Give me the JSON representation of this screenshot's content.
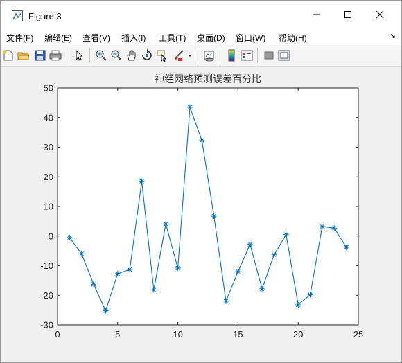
{
  "window": {
    "title": "Figure 3",
    "controls": {
      "minimize": "minimize",
      "maximize": "maximize",
      "close": "close"
    }
  },
  "menubar": {
    "items": [
      {
        "label": "文件(F)"
      },
      {
        "label": "编辑(E)"
      },
      {
        "label": "查看(V)"
      },
      {
        "label": "插入(I)"
      },
      {
        "label": "工具(T)"
      },
      {
        "label": "桌面(D)"
      },
      {
        "label": "窗口(W)"
      },
      {
        "label": "帮助(H)"
      }
    ],
    "overflow_icon": "dock-arrow-icon"
  },
  "toolbar": {
    "icons": [
      "new-figure-icon",
      "open-icon",
      "save-icon",
      "print-icon",
      "pointer-icon",
      "zoom-in-icon",
      "zoom-out-icon",
      "pan-icon",
      "rotate-icon",
      "data-cursor-icon",
      "brush-icon",
      "brush-dropdown-icon",
      "link-plot-icon",
      "colorbar-icon",
      "legend-icon",
      "hide-plot-tools-icon",
      "show-plot-tools-icon"
    ]
  },
  "colors": {
    "line": "#0072bd",
    "axes_bg": "#ffffff",
    "figure_bg": "#f0f0f0",
    "text": "#262626"
  },
  "chart_data": {
    "type": "line",
    "title": "神经网络预测误差百分比",
    "xlabel": "",
    "ylabel": "",
    "marker": "*",
    "xlim": [
      0,
      25
    ],
    "ylim": [
      -30,
      50
    ],
    "xticks": [
      0,
      5,
      10,
      15,
      20,
      25
    ],
    "yticks": [
      -30,
      -20,
      -10,
      0,
      10,
      20,
      30,
      40,
      50
    ],
    "grid": false,
    "series": [
      {
        "x": [
          1,
          2,
          3,
          4,
          5,
          6,
          7,
          8,
          9,
          10,
          11,
          12,
          13,
          14,
          15,
          16,
          17,
          18,
          19,
          20,
          21,
          22,
          23,
          24
        ],
        "values": [
          -0.5,
          -6,
          -16.3,
          -25.2,
          -12.7,
          -11.3,
          18.5,
          -18.2,
          4.1,
          -10.8,
          43.5,
          32.3,
          6.7,
          -22,
          -12,
          -2.8,
          -17.8,
          -6.3,
          0.5,
          -23.2,
          -19.8,
          3.2,
          2.7,
          -3.8
        ]
      }
    ]
  }
}
